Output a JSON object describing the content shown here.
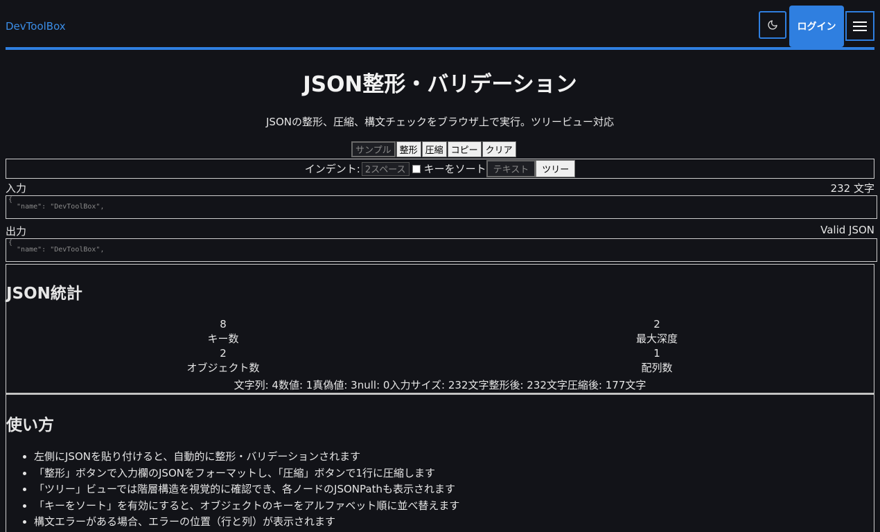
{
  "header": {
    "brand": "DevToolBox",
    "login_label": "ログイン",
    "theme_icon": "moon-icon",
    "menu_icon": "hamburger-icon",
    "accent_color": "#2f7fe0"
  },
  "page": {
    "title": "JSON整形・バリデーション",
    "subtitle": "JSONの整形、圧縮、構文チェックをブラウザ上で実行。ツリービュー対応"
  },
  "toolbar": {
    "sample": "サンプル",
    "format": "整形",
    "compress": "圧縮",
    "copy": "コピー",
    "clear": "クリア"
  },
  "options": {
    "indent_label": "インデント:",
    "indent_value": "2スペース",
    "sort_keys_label": "キーをソート",
    "sort_keys_checked": false,
    "view_text": "テキスト",
    "view_tree": "ツリー"
  },
  "input": {
    "label": "入力",
    "char_count": "232 文字",
    "content": "{\n  \"name\": \"DevToolBox\","
  },
  "output": {
    "label": "出力",
    "status": "Valid JSON",
    "content": "{\n  \"name\": \"DevToolBox\","
  },
  "stats": {
    "heading": "JSON統計",
    "keys_value": "8",
    "keys_label": "キー数",
    "depth_value": "2",
    "depth_label": "最大深度",
    "objects_value": "2",
    "objects_label": "オブジェクト数",
    "arrays_value": "1",
    "arrays_label": "配列数",
    "strings": "文字列: 4",
    "numbers": "数値: 1",
    "booleans": "真偽値: 3",
    "nulls": "null: 0",
    "input_size": "入力サイズ: 232文字",
    "formatted_size": "整形後: 232文字",
    "compressed_size": "圧縮後: 177文字"
  },
  "usage": {
    "heading": "使い方",
    "items": [
      "左側にJSONを貼り付けると、自動的に整形・バリデーションされます",
      "「整形」ボタンで入力欄のJSONをフォーマットし、「圧縮」ボタンで1行に圧縮します",
      "「ツリー」ビューでは階層構造を視覚的に確認でき、各ノードのJSONPathも表示されます",
      "「キーをソート」を有効にすると、オブジェクトのキーをアルファベット順に並べ替えます",
      "構文エラーがある場合、エラーの位置（行と列）が表示されます"
    ]
  }
}
